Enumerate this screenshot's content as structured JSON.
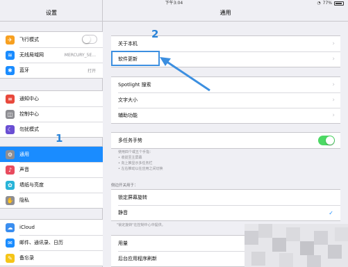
{
  "status_bar": {
    "time": "下午3:04",
    "battery": "77%"
  },
  "sidebar": {
    "title": "设置",
    "groups": [
      [
        {
          "label": "飞行模式",
          "icon": "airplane-icon",
          "color": "#f7a020",
          "toggle": "off"
        },
        {
          "label": "无线局域网",
          "icon": "wifi-icon",
          "color": "#1a8cff",
          "value": "MERCURY_5E..."
        },
        {
          "label": "蓝牙",
          "icon": "bluetooth-icon",
          "color": "#1a8cff",
          "value": "打开"
        }
      ],
      [
        {
          "label": "通知中心",
          "icon": "notification-icon",
          "color": "#e8493c"
        },
        {
          "label": "控制中心",
          "icon": "control-center-icon",
          "color": "#8e8e93"
        },
        {
          "label": "勿扰模式",
          "icon": "moon-icon",
          "color": "#6a4fd3"
        }
      ],
      [
        {
          "label": "通用",
          "icon": "gear-icon",
          "color": "#8e8e93",
          "selected": true
        },
        {
          "label": "声音",
          "icon": "sound-icon",
          "color": "#e84b5e"
        },
        {
          "label": "墙纸与亮度",
          "icon": "wallpaper-icon",
          "color": "#28b4d8"
        },
        {
          "label": "隐私",
          "icon": "hand-icon",
          "color": "#8e8e93"
        }
      ],
      [
        {
          "label": "iCloud",
          "icon": "cloud-icon",
          "color": "#3a8ef0"
        },
        {
          "label": "邮件、通讯录、日历",
          "icon": "mail-icon",
          "color": "#1a8cff"
        },
        {
          "label": "备忘录",
          "icon": "notes-icon",
          "color": "#f5c518"
        }
      ]
    ]
  },
  "main": {
    "title": "通用",
    "group1": [
      {
        "label": "关于本机"
      },
      {
        "label": "软件更新"
      }
    ],
    "group2": [
      {
        "label": "Spotlight 搜索"
      },
      {
        "label": "文字大小"
      },
      {
        "label": "辅助功能"
      }
    ],
    "multitask": {
      "label": "多任务手势",
      "toggle": "on"
    },
    "multitask_note": [
      "使用四个或五个手指：",
      "• 收拢至主屏幕",
      "• 向上推显示多任务栏",
      "• 左右推动以在应用之间切换"
    ],
    "side_switch_label": "侧边开关用于：",
    "group4": [
      {
        "label": "锁定屏幕旋转"
      },
      {
        "label": "静音",
        "checked": true
      }
    ],
    "side_switch_note": "\"锁定旋转\"在控制中心中提供。",
    "group5": [
      {
        "label": "用量"
      },
      {
        "label": "后台应用程序刷新"
      }
    ]
  },
  "annotations": {
    "label_1": "1",
    "label_2": "2",
    "color": "#2b84d8"
  }
}
